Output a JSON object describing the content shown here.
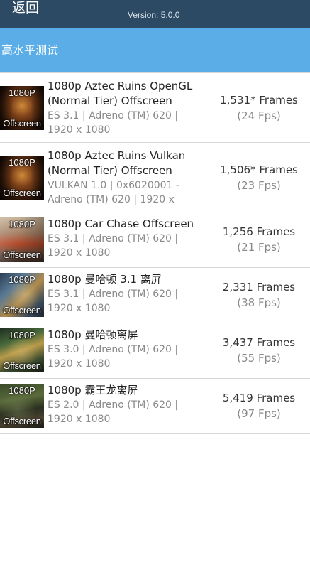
{
  "topbar": {
    "back_label": "返回",
    "version": "Version: 5.0.0"
  },
  "section": {
    "title": "高水平测试"
  },
  "tests": [
    {
      "thumb_res": "1080P",
      "thumb_mode": "Offscreen",
      "name": "1080p Aztec Ruins OpenGL (Normal Tier) Offscreen",
      "detail": "ES 3.1 | Adreno (TM) 620 | 1920 x 1080",
      "frames": "1,531* Frames",
      "fps": "(24 Fps)"
    },
    {
      "thumb_res": "1080P",
      "thumb_mode": "Offscreen",
      "name": "1080p Aztec Ruins Vulkan (Normal Tier) Offscreen",
      "detail": "VULKAN 1.0 | 0x6020001 - Adreno (TM) 620 | 1920 x",
      "frames": "1,506* Frames",
      "fps": "(23 Fps)"
    },
    {
      "thumb_res": "1080P",
      "thumb_mode": "Offscreen",
      "name": "1080p Car Chase Offscreen",
      "detail": "ES 3.1 | Adreno (TM) 620 | 1920 x 1080",
      "frames": "1,256 Frames",
      "fps": "(21 Fps)"
    },
    {
      "thumb_res": "1080P",
      "thumb_mode": "Offscreen",
      "name": "1080p 曼哈顿 3.1 离屏",
      "detail": "ES 3.1 | Adreno (TM) 620 | 1920 x 1080",
      "frames": "2,331 Frames",
      "fps": "(38 Fps)"
    },
    {
      "thumb_res": "1080P",
      "thumb_mode": "Offscreen",
      "name": "1080p 曼哈顿离屏",
      "detail": "ES 3.0 | Adreno (TM) 620 | 1920 x 1080",
      "frames": "3,437 Frames",
      "fps": "(55 Fps)"
    },
    {
      "thumb_res": "1080P",
      "thumb_mode": "Offscreen",
      "name": "1080p 霸王龙离屏",
      "detail": "ES 2.0 | Adreno (TM) 620 | 1920 x 1080",
      "frames": "5,419 Frames",
      "fps": "(97 Fps)"
    }
  ]
}
